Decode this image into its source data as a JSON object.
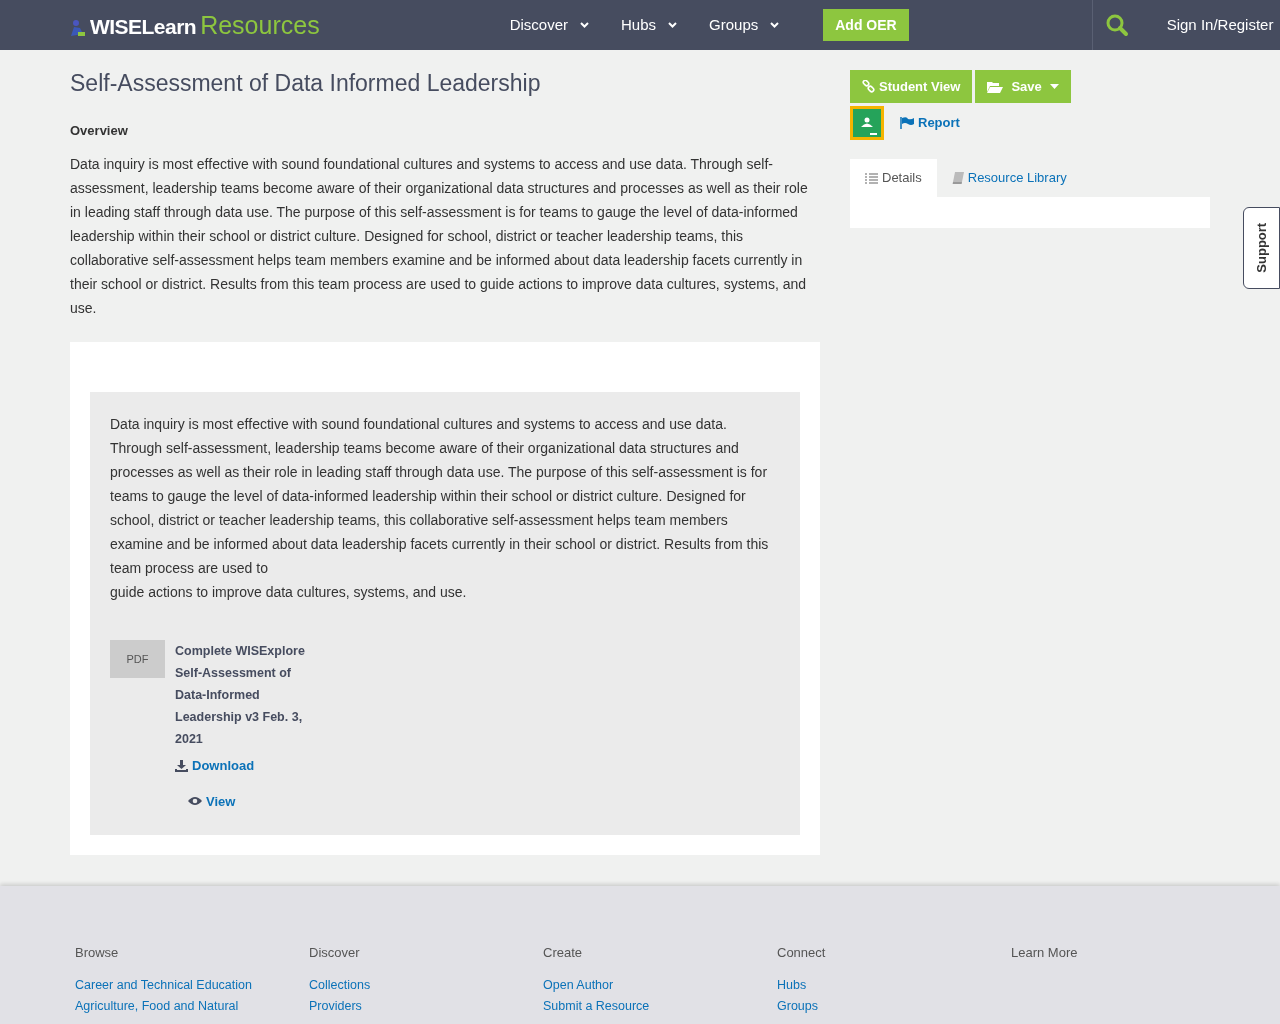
{
  "header": {
    "logo_primary": "WISELearn",
    "logo_secondary": "Resources",
    "nav": [
      {
        "label": "Discover"
      },
      {
        "label": "Hubs"
      },
      {
        "label": "Groups"
      }
    ],
    "add_button": "Add OER",
    "sign_in": "Sign In/Register"
  },
  "title": "Self-Assessment of Data Informed Leadership",
  "overview_heading": "Overview",
  "overview": "Data inquiry is most effective with sound foundational cultures and systems to access and use data. Through self-assessment, leadership teams become aware of their organizational data structures and processes as well as their role in leading staff through data use. The purpose of this self-assessment is for teams to gauge the level of data-informed leadership within their school or district culture. Designed for school, district or teacher leadership teams, this collaborative self-assessment helps team members examine and be informed about data leadership facets currently in their school or district. Results from this team process are used to guide actions to improve data cultures, systems, and use.",
  "content_text": "Data inquiry is most effective with sound foundational cultures and systems to access and use data. Through self-assessment, leadership teams become aware of their organizational data structures and processes as well as their role in leading staff through data use. The purpose of this self-assessment is for teams to gauge the level of data-informed leadership within their school or district culture. Designed for school, district or teacher leadership teams, this collaborative self-assessment helps team members examine and be informed about data leadership facets currently in their school or district. Results from this team process are used to\nguide actions to improve data cultures, systems, and use.",
  "attachment": {
    "type_label": "PDF",
    "name": "Complete WISExplore Self-Assessment of Data-Informed Leadership v3 Feb. 3, 2021",
    "download": "Download",
    "view": "View"
  },
  "actions": {
    "student_view": "Student View",
    "save": "Save",
    "report": "Report"
  },
  "tabs": [
    {
      "label": "Details",
      "selected": true
    },
    {
      "label": "Resource Library",
      "selected": false
    }
  ],
  "support": "Support",
  "footer": [
    {
      "heading": "Browse",
      "links": [
        "Career and Technical Education",
        "Agriculture, Food and Natural"
      ]
    },
    {
      "heading": "Discover",
      "links": [
        "Collections",
        "Providers"
      ]
    },
    {
      "heading": "Create",
      "links": [
        "Open Author",
        "Submit a Resource"
      ]
    },
    {
      "heading": "Connect",
      "links": [
        "Hubs",
        "Groups"
      ]
    },
    {
      "heading": "Learn More"
    }
  ]
}
